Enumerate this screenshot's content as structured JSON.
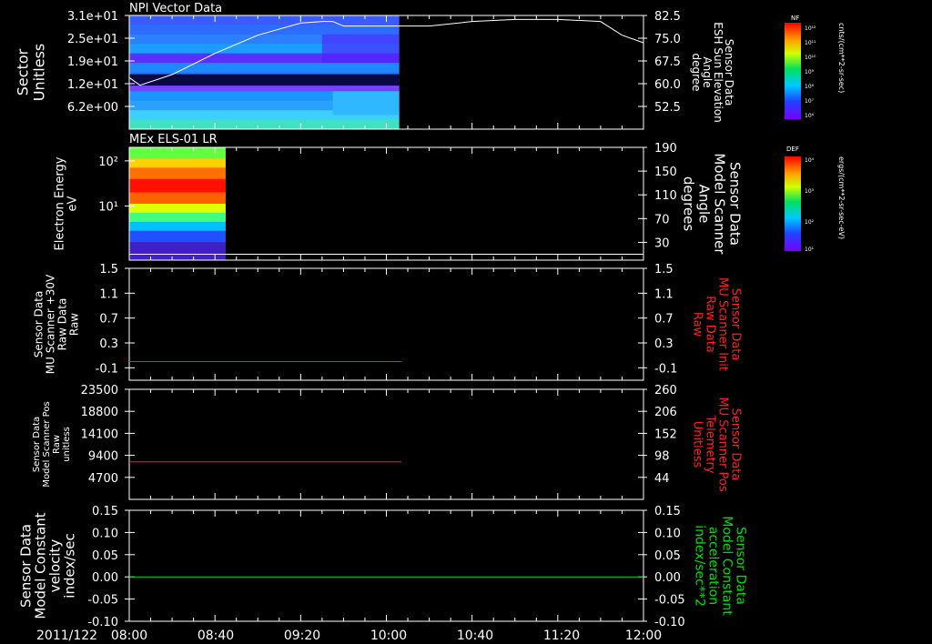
{
  "figure": {
    "date_label": "2011/122",
    "time_ticks": [
      "08:00",
      "08:40",
      "09:20",
      "10:00",
      "10:40",
      "11:20",
      "12:00"
    ]
  },
  "colors": {
    "background": "#000000",
    "axis": "#ffffff",
    "red_trace": "#ff2020",
    "green_trace": "#00e000"
  },
  "chart_data": [
    {
      "type": "heatmap",
      "title": "NPI Vector Data",
      "ylabel": [
        "Sector",
        "Unitless"
      ],
      "yticks": [
        "3.1e+01",
        "2.5e+01",
        "1.9e+01",
        "1.2e+01",
        "6.2e+00"
      ],
      "right_label": [
        "Sensor Data",
        "ESH Sun Elevation",
        "Angle",
        "degree"
      ],
      "right_ticks": [
        "82.5",
        "75.0",
        "67.5",
        "60.0",
        "52.5"
      ],
      "ylim_right": [
        45.0,
        82.5
      ],
      "heatmap_end_time": "10:06",
      "overlay_line": {
        "name": "ESH Sun Elevation Angle",
        "times": [
          "08:00",
          "08:05",
          "08:20",
          "08:40",
          "09:00",
          "09:20",
          "09:30",
          "09:35",
          "09:40",
          "10:00",
          "10:20",
          "10:40",
          "11:00",
          "11:20",
          "11:40",
          "11:50",
          "12:00"
        ],
        "values": [
          62.0,
          59.5,
          63.0,
          70.0,
          76.0,
          80.0,
          80.5,
          80.5,
          79.0,
          79.0,
          79.0,
          80.5,
          81.2,
          81.2,
          80.5,
          76.0,
          73.5
        ]
      },
      "colorbar": {
        "label": "NF",
        "units": "cnts/(cm**2-sr-sec)",
        "ticks": [
          "10¹²",
          "10¹¹",
          "10¹⁰",
          "10⁹",
          "10⁸",
          "10⁷",
          "10⁶"
        ]
      }
    },
    {
      "type": "heatmap",
      "title": "MEx ELS-01 LR",
      "ylabel": [
        "Electron Energy",
        "eV"
      ],
      "yticks": [
        "10²",
        "10¹"
      ],
      "right_label": [
        "Sensor Data",
        "Model Scanner",
        "Angle",
        "degrees"
      ],
      "right_ticks": [
        "190",
        "150",
        "110",
        "70",
        "30"
      ],
      "ylim_right": [
        0,
        190
      ],
      "heatmap_end_time": "08:45",
      "overlay_line": {
        "name": "Model Scanner Angle",
        "times": [
          "08:00",
          "12:00"
        ],
        "values": [
          10,
          10
        ]
      },
      "colorbar": {
        "label": "DEF",
        "units": "ergs/(cm**2-sr-sec-eV)",
        "ticks": [
          "10⁴",
          "10³",
          "10²",
          "10¹"
        ]
      }
    },
    {
      "type": "line",
      "ylabel": [
        "Sensor Data",
        "MU Scanner +30V",
        "Raw Data",
        "Raw"
      ],
      "yticks": [
        "1.5",
        "1.1",
        "0.7",
        "0.3",
        "-0.1"
      ],
      "right_label": [
        "Sensor Data",
        "MU Scanner Init",
        "Raw Data",
        "Raw"
      ],
      "right_ticks": [
        "1.5",
        "1.1",
        "0.7",
        "0.3",
        "-0.1"
      ],
      "ylim": [
        -0.3,
        1.5
      ],
      "series": [
        {
          "times": [
            "08:00",
            "10:07"
          ],
          "values": [
            0.0,
            0.0
          ]
        }
      ]
    },
    {
      "type": "line",
      "ylabel": [
        "Sensor Data",
        "Model Scanner Pos",
        "Raw",
        "unitless"
      ],
      "yticks": [
        "23500",
        "18800",
        "14100",
        "9400",
        "4700"
      ],
      "right_label": [
        "Sensor Data",
        "MU Scanner Pos",
        "Telemetry",
        "Unitless"
      ],
      "right_ticks": [
        "260",
        "206",
        "152",
        "98",
        "44"
      ],
      "ylim": [
        0,
        23500
      ],
      "series": [
        {
          "times": [
            "08:00",
            "10:07"
          ],
          "values": [
            8000,
            8000
          ]
        }
      ]
    },
    {
      "type": "line",
      "ylabel": [
        "Sensor Data",
        "Model Constant",
        "velocity",
        "index/sec"
      ],
      "yticks": [
        "0.15",
        "0.10",
        "0.05",
        "0.00",
        "-0.05",
        "-0.10"
      ],
      "right_label": [
        "Sensor Data",
        "Model Constant",
        "acceleration",
        "index/sec**2"
      ],
      "right_ticks": [
        "0.15",
        "0.10",
        "0.05",
        "0.00",
        "-0.05",
        "-0.10"
      ],
      "ylim": [
        -0.1,
        0.15
      ],
      "series": [
        {
          "times": [
            "08:00",
            "12:00"
          ],
          "values": [
            0.0,
            0.0
          ]
        }
      ]
    }
  ]
}
